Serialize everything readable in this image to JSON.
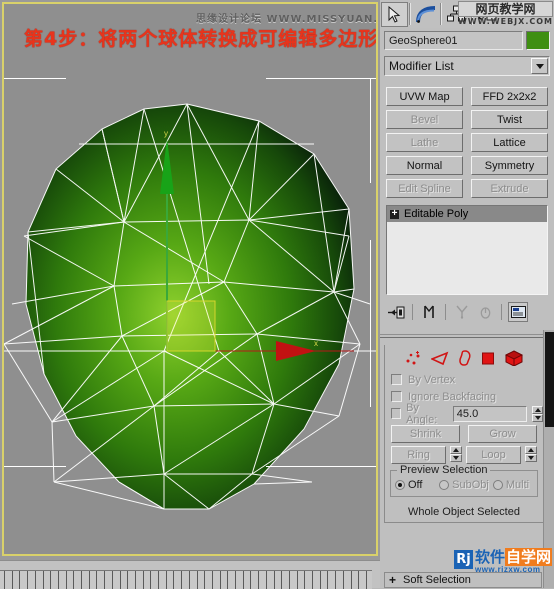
{
  "viewport": {
    "overlay_title": "第4步：将两个球体转换成可编辑多边形",
    "watermark_top": "思缘设计论坛 WWW.MISSYUAN.COM",
    "axis_x_label": "x",
    "axis_y_label": "y",
    "object_color": "#3f8f12",
    "background_color": "#8f8f8f",
    "border_color": "#d9d16a",
    "wireframe_color": "#ffffff"
  },
  "toolbar": {
    "buttons": [
      {
        "name": "select-object",
        "icon": "arrow-cursor-icon",
        "selected": true
      },
      {
        "name": "select-and-link",
        "icon": "curve-arc-icon",
        "selected": false
      },
      {
        "name": "schematic-view",
        "icon": "hierarchy-tree-icon",
        "selected": false
      },
      {
        "name": "render-scene",
        "icon": "teapot-render-icon",
        "selected": false
      }
    ]
  },
  "watermark_top_right": {
    "line1": "网页教学网",
    "line2": "WWW.WEBJX.COM"
  },
  "watermark_bottom_right": {
    "logo": "Rj",
    "text_blue": "软件",
    "text_orange": "自学网",
    "url": "www.rjzxw.com"
  },
  "command_panel": {
    "object_name": "GeoSphere01",
    "object_color": "#3f8f12",
    "modifier_list_label": "Modifier List",
    "modifier_buttons": [
      {
        "label": "UVW Map",
        "enabled": true
      },
      {
        "label": "FFD 2x2x2",
        "enabled": true
      },
      {
        "label": "Bevel",
        "enabled": false
      },
      {
        "label": "Twist",
        "enabled": true
      },
      {
        "label": "Lathe",
        "enabled": false
      },
      {
        "label": "Lattice",
        "enabled": true
      },
      {
        "label": "Normal",
        "enabled": true
      },
      {
        "label": "Symmetry",
        "enabled": true
      },
      {
        "label": "Edit Spline",
        "enabled": false
      },
      {
        "label": "Extrude",
        "enabled": false
      }
    ],
    "modifier_stack": [
      {
        "label": "Editable Poly",
        "expanded": false,
        "selected": true
      }
    ],
    "stack_tools": [
      {
        "name": "pin-stack-icon"
      },
      {
        "name": "show-end-result-icon"
      },
      {
        "name": "make-unique-icon"
      },
      {
        "name": "remove-modifier-icon"
      },
      {
        "name": "configure-modifier-sets-icon"
      }
    ],
    "selection_rollout": {
      "subobject_icons": [
        {
          "name": "vertex-icon"
        },
        {
          "name": "edge-icon"
        },
        {
          "name": "border-icon"
        },
        {
          "name": "polygon-icon"
        },
        {
          "name": "element-icon"
        }
      ],
      "by_vertex_label": "By Vertex",
      "by_vertex_checked": false,
      "ignore_backfacing_label": "Ignore Backfacing",
      "ignore_backfacing_checked": false,
      "by_angle_label": "By Angle:",
      "by_angle_checked": false,
      "by_angle_value": "45.0",
      "shrink_label": "Shrink",
      "grow_label": "Grow",
      "ring_label": "Ring",
      "loop_label": "Loop",
      "preview_group_title": "Preview Selection",
      "preview_options": [
        {
          "label": "Off",
          "selected": true,
          "enabled": true
        },
        {
          "label": "SubObj",
          "selected": false,
          "enabled": false
        },
        {
          "label": "Multi",
          "selected": false,
          "enabled": false
        }
      ],
      "status_text": "Whole Object Selected"
    },
    "bottom_rollout": {
      "expander": "+",
      "label": "Soft Selection"
    }
  }
}
